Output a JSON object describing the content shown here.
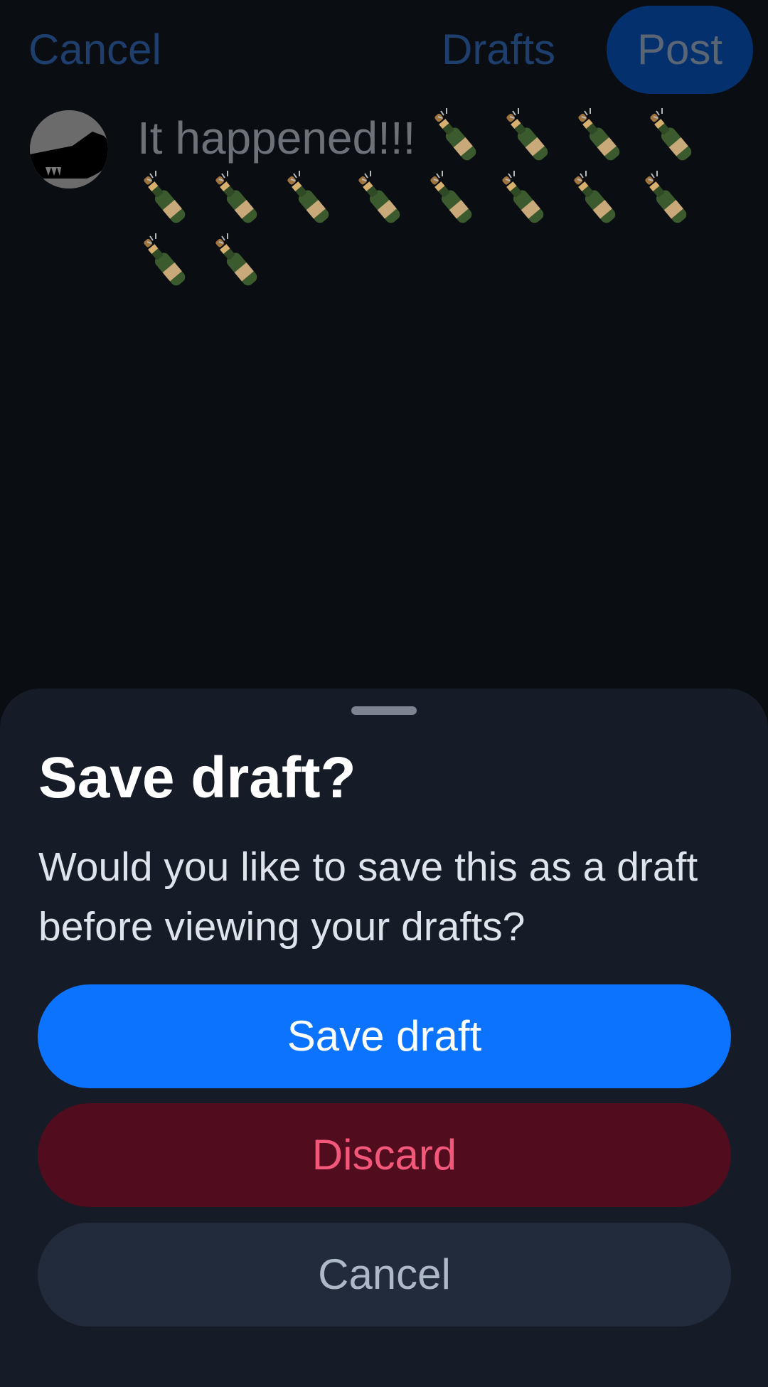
{
  "composer": {
    "cancel_label": "Cancel",
    "drafts_label": "Drafts",
    "post_label": "Post",
    "post_text": "It happened!!!",
    "emoji_count": 14,
    "emoji_icon": "bottle-with-popping-cork-icon"
  },
  "sheet": {
    "title": "Save draft?",
    "message": "Would you like to save this as a draft before viewing your drafts?",
    "save_label": "Save draft",
    "discard_label": "Discard",
    "cancel_label": "Cancel"
  },
  "colors": {
    "primary": "#0c73fe",
    "destructive_bg": "#510c1d",
    "destructive_text": "#f3587a",
    "sheet_bg": "#161c27",
    "background": "#0a0d12"
  }
}
